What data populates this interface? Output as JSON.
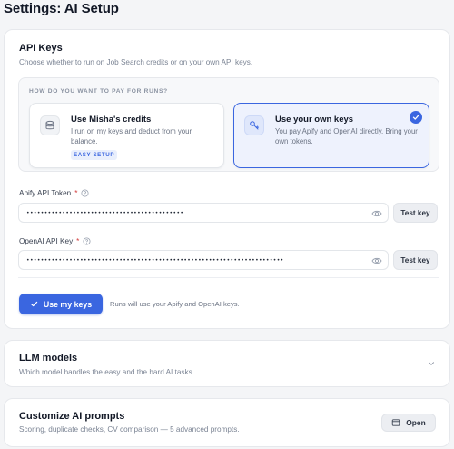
{
  "page": {
    "title": "Settings: AI Setup"
  },
  "api_keys": {
    "title": "API Keys",
    "subtitle": "Choose whether to run on Job Search credits or on your own API keys.",
    "question": "HOW DO YOU WANT TO PAY FOR RUNS?",
    "options": [
      {
        "title": "Use Misha's credits",
        "description": "I run on my keys and deduct from your balance.",
        "badge": "EASY SETUP",
        "icon": "database-icon",
        "selected": false
      },
      {
        "title": "Use your own keys",
        "description": "You pay Apify and OpenAI directly. Bring your own tokens.",
        "icon": "key-icon",
        "selected": true
      }
    ],
    "apify": {
      "label": "Apify API Token",
      "value": "••••••••••••••••••••••••••••••••••••••••••••",
      "test_label": "Test key"
    },
    "openai": {
      "label": "OpenAI API Key",
      "value": "••••••••••••••••••••••••••••••••••••••••••••••••••••••••••••••••••••••••",
      "test_label": "Test key"
    },
    "primary_button": "Use my keys",
    "primary_note": "Runs will use your Apify and OpenAI keys."
  },
  "llm": {
    "title": "LLM models",
    "subtitle": "Which model handles the easy and the hard AI tasks."
  },
  "prompts": {
    "title": "Customize AI prompts",
    "subtitle": "Scoring, duplicate checks, CV comparison — 5 advanced prompts.",
    "open_label": "Open"
  },
  "colors": {
    "accent": "#3a66e0",
    "background": "#f4f5f7",
    "card": "#ffffff"
  }
}
